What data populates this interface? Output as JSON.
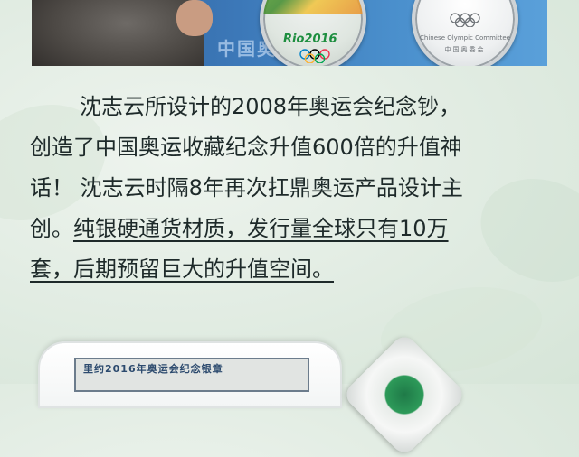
{
  "banner": {
    "wall_text": "中国奥",
    "coin_left": {
      "logo_text": "Rio2016"
    },
    "coin_right": {
      "caption_en": "Chinese Olympic Committee",
      "caption_cn": "中国奥委会"
    },
    "colors": {
      "blue_backdrop": "#3c78b8",
      "rio_green": "#1d8e3f"
    }
  },
  "paragraph": {
    "line1": "沈志云所设计的2008年奥运会纪念钞，",
    "line2": "创造了中国奥运收藏纪念升值600倍的升值神",
    "line3": "话！  沈志云时隔8年再次扛鼎奥运产品设计主",
    "line4_prefix": "创。",
    "line4_underlined": "纯银硬通货材质，发行量全球只有10万",
    "line5_underlined": "套，后期预留巨大的升值空间。"
  },
  "product": {
    "label_text": "里约2016年奥运会纪念银章"
  }
}
